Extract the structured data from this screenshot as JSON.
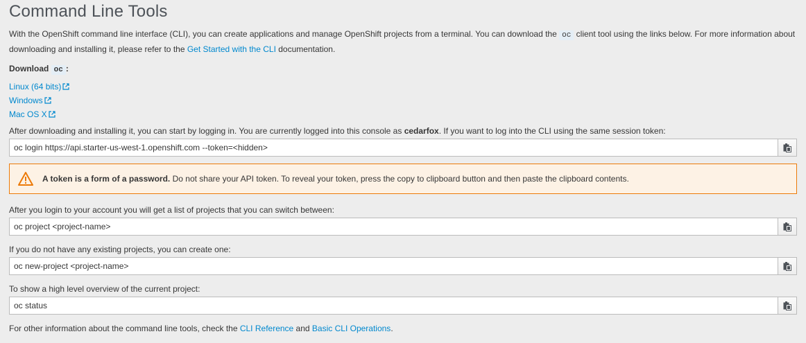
{
  "title": "Command Line Tools",
  "intro": {
    "part1": "With the OpenShift command line interface (CLI), you can create applications and manage OpenShift projects from a terminal. You can download the ",
    "code": "oc",
    "part2": " client tool using the links below. For more information about downloading and installing it, please refer to the ",
    "link": "Get Started with the CLI",
    "part3": " documentation."
  },
  "download": {
    "label": "Download ",
    "code": "oc",
    "suffix": ":",
    "links": [
      "Linux (64 bits)",
      "Windows",
      "Mac OS X"
    ]
  },
  "login": {
    "text1": "After downloading and installing it, you can start by logging in. You are currently logged into this console as ",
    "user": "cedarfox",
    "text2": ". If you want to log into the CLI using the same session token:",
    "command": "oc login https://api.starter-us-west-1.openshift.com --token=<hidden>"
  },
  "alert": {
    "bold": "A token is a form of a password.",
    "text": " Do not share your API token. To reveal your token, press the copy to clipboard button and then paste the clipboard contents."
  },
  "projects": {
    "text": "After you login to your account you will get a list of projects that you can switch between:",
    "command": "oc project <project-name>"
  },
  "new_project": {
    "text": "If you do not have any existing projects, you can create one:",
    "command": "oc new-project <project-name>"
  },
  "status": {
    "text": "To show a high level overview of the current project:",
    "command": "oc status"
  },
  "footer": {
    "text1": "For other information about the command line tools, check the ",
    "link1": "CLI Reference",
    "text2": " and ",
    "link2": "Basic CLI Operations",
    "text3": "."
  },
  "icons": {
    "external": "external-link-icon",
    "copy": "copy-to-clipboard-icon",
    "warning": "warning-triangle-icon"
  },
  "colors": {
    "link": "#0088ce",
    "warning": "#ec7a08",
    "alert_bg": "#fdf2e5"
  }
}
